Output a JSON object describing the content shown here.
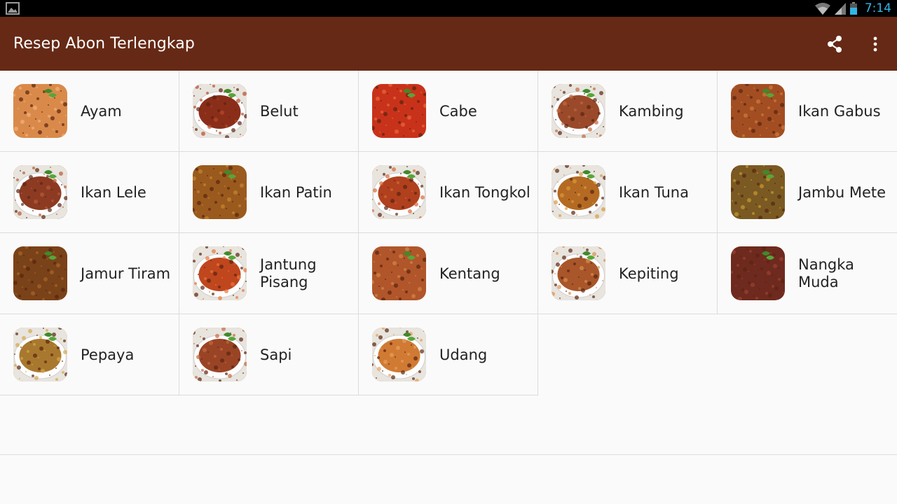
{
  "status_bar": {
    "time": "7:14",
    "icons": [
      "picture-icon",
      "wifi-icon",
      "signal-icon",
      "battery-icon"
    ]
  },
  "app_bar": {
    "title": "Resep Abon Terlengkap",
    "actions": [
      "share-icon",
      "overflow-menu-icon"
    ],
    "color": "#662915"
  },
  "items": [
    {
      "label": "Ayam",
      "colors": [
        "#d98a4a",
        "#f2b27a"
      ],
      "plate": false
    },
    {
      "label": "Belut",
      "colors": [
        "#8a2e1a",
        "#b84a2a"
      ],
      "plate": true
    },
    {
      "label": "Cabe",
      "colors": [
        "#c9321a",
        "#e86a3a"
      ],
      "plate": false
    },
    {
      "label": "Kambing",
      "colors": [
        "#9a4a2a",
        "#c06a3e"
      ],
      "plate": true
    },
    {
      "label": "Ikan Gabus",
      "colors": [
        "#a24e22",
        "#d07a3a"
      ],
      "plate": false
    },
    {
      "label": "Ikan Lele",
      "colors": [
        "#8c3a22",
        "#b85a36"
      ],
      "plate": true
    },
    {
      "label": "Ikan Patin",
      "colors": [
        "#9a5a1e",
        "#c8862e"
      ],
      "plate": false
    },
    {
      "label": "Ikan Tongkol",
      "colors": [
        "#b0401e",
        "#d66a3a"
      ],
      "plate": true
    },
    {
      "label": "Ikan Tuna",
      "colors": [
        "#b46a22",
        "#d99a3a"
      ],
      "plate": true
    },
    {
      "label": "Jambu Mete",
      "colors": [
        "#7a5a22",
        "#c89a30"
      ],
      "plate": false
    },
    {
      "label": "Jamur Tiram",
      "colors": [
        "#7a4218",
        "#a8662a"
      ],
      "plate": false
    },
    {
      "label": "Jantung Pisang",
      "colors": [
        "#c0461e",
        "#e8763a"
      ],
      "plate": true
    },
    {
      "label": "Kentang",
      "colors": [
        "#b0562a",
        "#d8844a"
      ],
      "plate": false
    },
    {
      "label": "Kepiting",
      "colors": [
        "#a8562a",
        "#d8904e"
      ],
      "plate": true
    },
    {
      "label": "Nangka Muda",
      "colors": [
        "#6e2a1e",
        "#9a4232"
      ],
      "plate": false
    },
    {
      "label": "Pepaya",
      "colors": [
        "#a8782e",
        "#d4a84e"
      ],
      "plate": true
    },
    {
      "label": "Sapi",
      "colors": [
        "#9a4426",
        "#c46a3e"
      ],
      "plate": true
    },
    {
      "label": "Udang",
      "colors": [
        "#d07a34",
        "#e8a05a"
      ],
      "plate": true
    }
  ]
}
